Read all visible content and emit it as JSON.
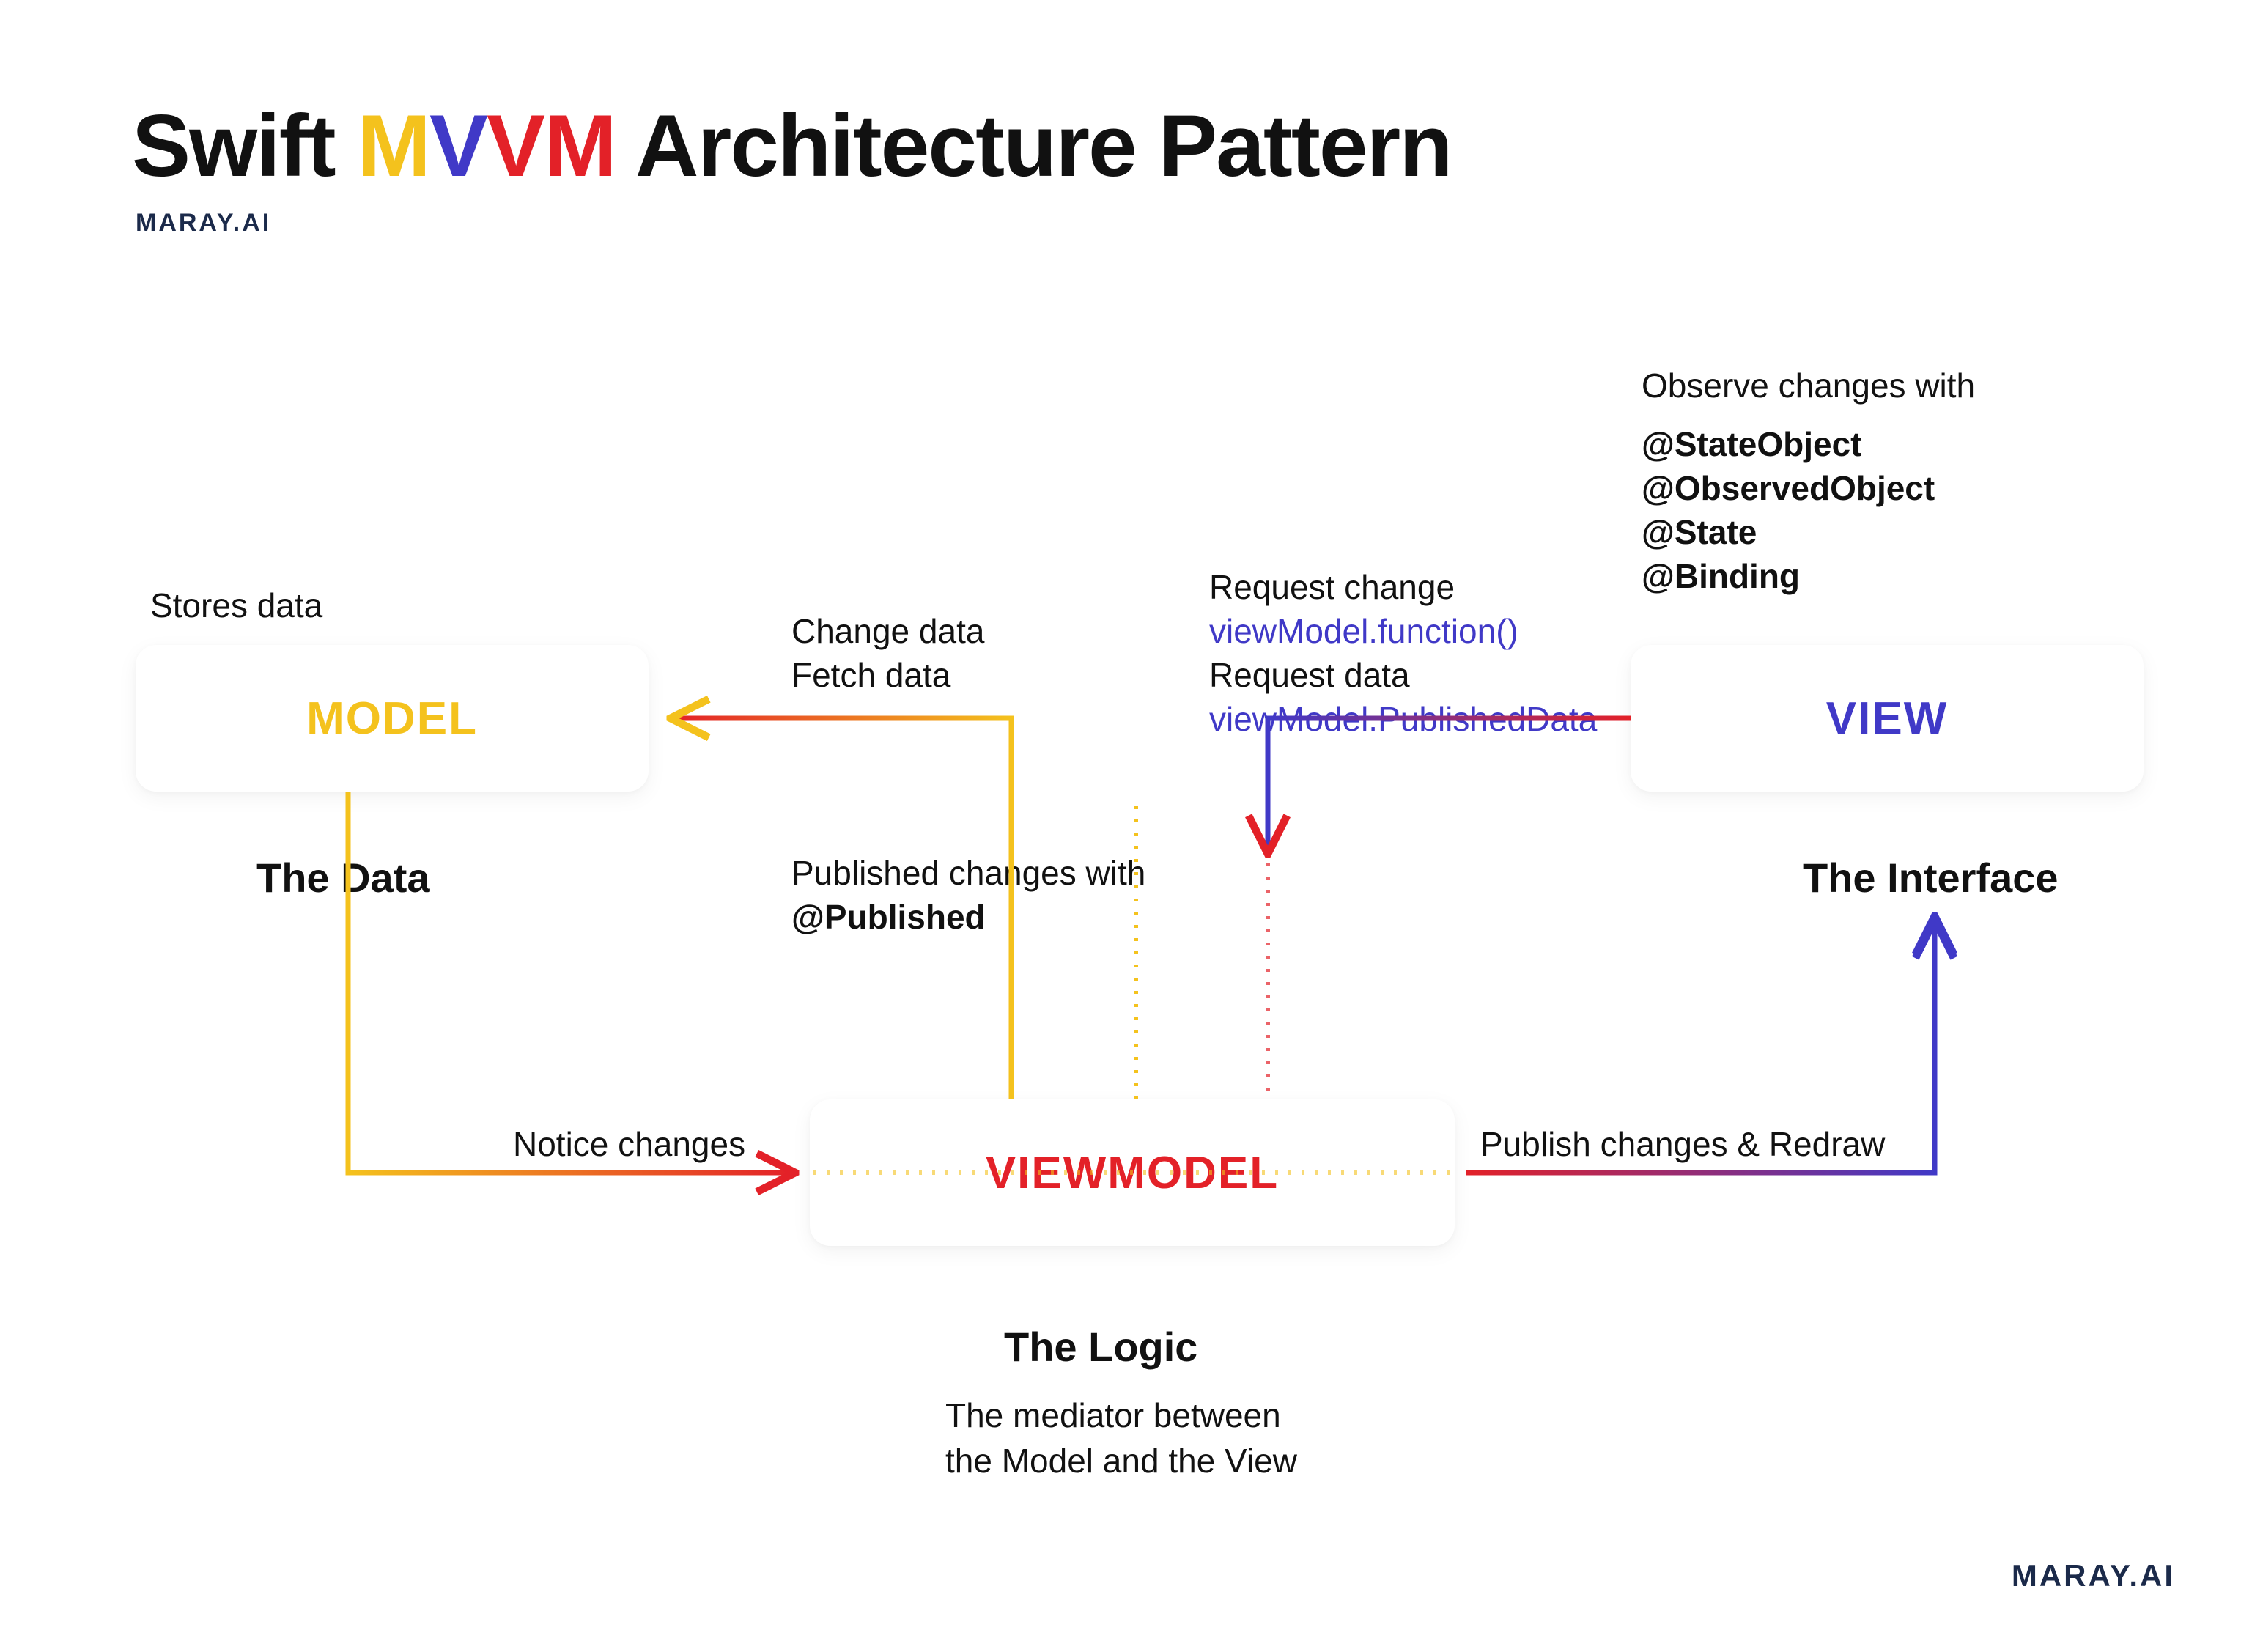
{
  "header": {
    "title_prefix": "Swift ",
    "mvvm_m1": "M",
    "mvvm_v1": "V",
    "mvvm_v2": "V",
    "mvvm_m2": "M",
    "title_suffix": " Architecture Pattern",
    "brand": "MARAY.AI"
  },
  "boxes": {
    "model": {
      "label": "MODEL",
      "tag": "The Data",
      "above": "Stores data"
    },
    "view": {
      "label": "VIEW",
      "tag": "The Interface",
      "observe_intro": "Observe changes with",
      "observe_items": [
        "@StateObject",
        "@ObservedObject",
        "@State",
        "@Binding"
      ]
    },
    "viewmodel": {
      "label": "VIEWMODEL",
      "tag": "The Logic",
      "description": "The mediator between\nthe Model and the View"
    }
  },
  "arrows": {
    "vm_to_model": {
      "line1": "Change data",
      "line2": "Fetch data"
    },
    "model_to_vm": {
      "label": "Notice changes"
    },
    "vm_publish": {
      "line1": "Published changes with",
      "line2": "@Published"
    },
    "view_to_vm_change": {
      "label": "Request change",
      "code": "viewModel.function()"
    },
    "view_to_vm_data": {
      "label": "Request data",
      "code": "viewModel.PublishedData"
    },
    "vm_to_view": {
      "label": "Publish changes & Redraw"
    }
  },
  "footer": {
    "brand": "MARAY.AI"
  }
}
